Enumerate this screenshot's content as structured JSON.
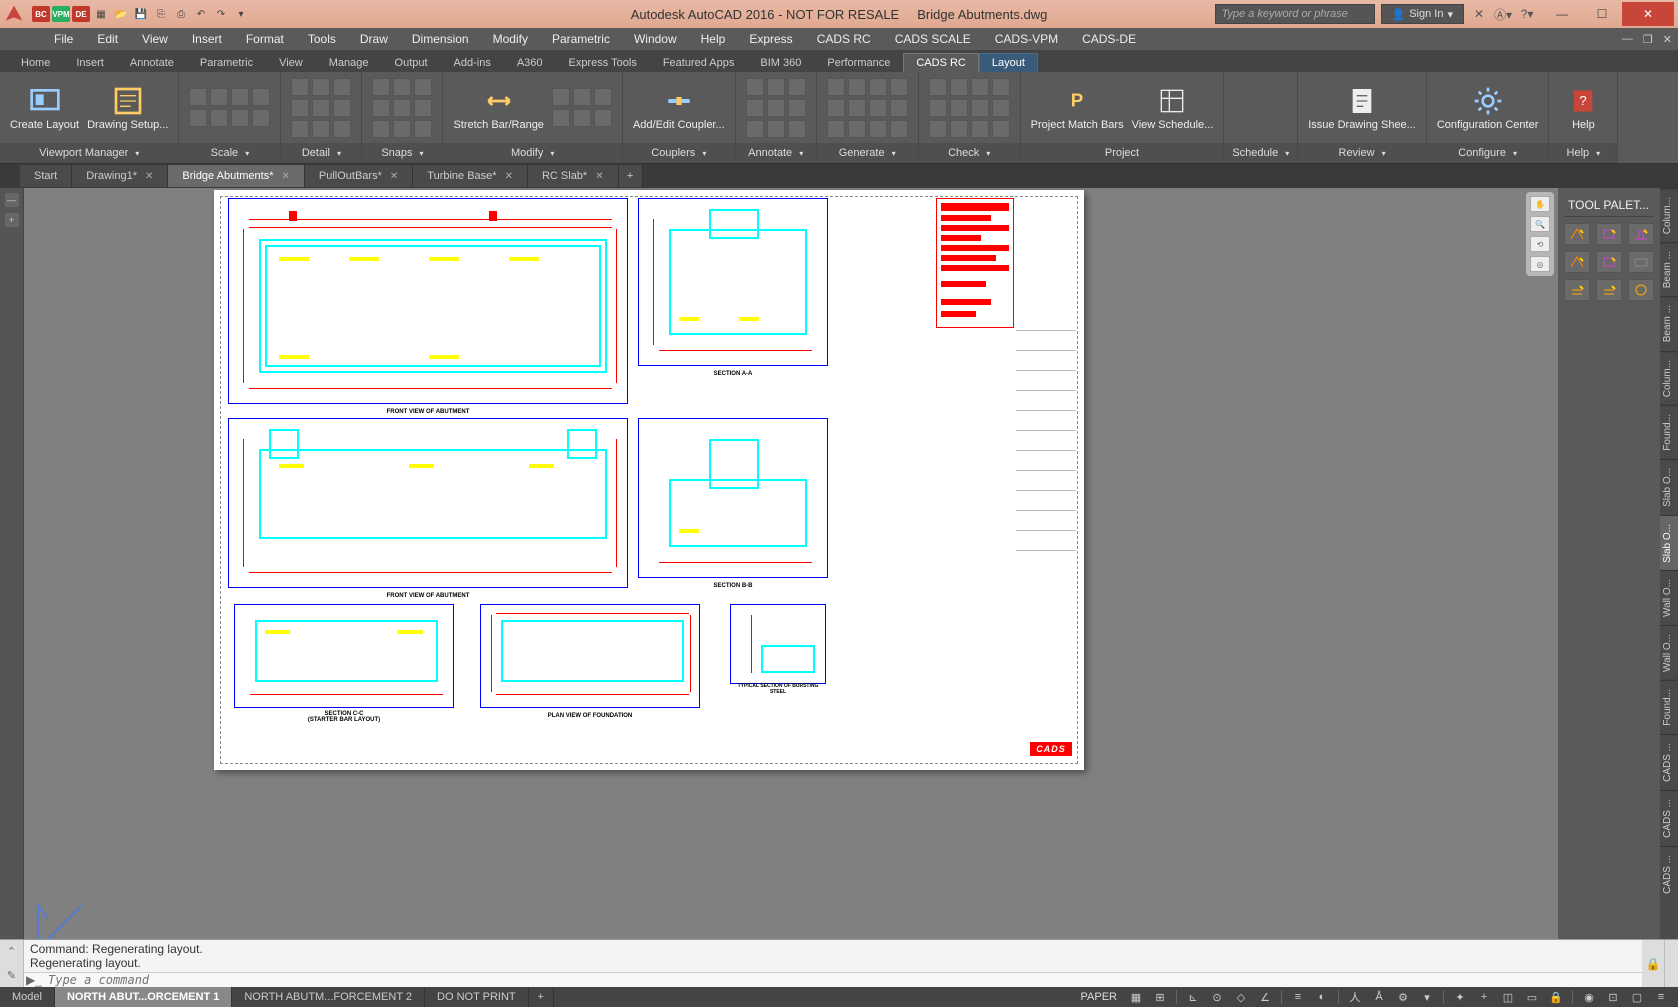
{
  "titlebar": {
    "app_title": "Autodesk AutoCAD 2016 - NOT FOR RESALE",
    "file_title": "Bridge Abutments.dwg",
    "search_placeholder": "Type a keyword or phrase",
    "signin": "Sign In",
    "qat_badges": [
      {
        "label": "BC",
        "color": "#c0392b"
      },
      {
        "label": "VPM",
        "color": "#27ae60"
      },
      {
        "label": "DE",
        "color": "#c0392b"
      }
    ]
  },
  "menus": [
    "File",
    "Edit",
    "View",
    "Insert",
    "Format",
    "Tools",
    "Draw",
    "Dimension",
    "Modify",
    "Parametric",
    "Window",
    "Help",
    "Express",
    "CADS RC",
    "CADS SCALE",
    "CADS-VPM",
    "CADS-DE"
  ],
  "ribbon_tabs": [
    "Home",
    "Insert",
    "Annotate",
    "Parametric",
    "View",
    "Manage",
    "Output",
    "Add-ins",
    "A360",
    "Express Tools",
    "Featured Apps",
    "BIM 360",
    "Performance",
    "CADS RC",
    "Layout"
  ],
  "ribbon_active_tab": "CADS RC",
  "ribbon_context_tab": "Layout",
  "ribbon_panels": [
    {
      "title": "Viewport Manager",
      "buttons": [
        {
          "label": "Create Layout"
        },
        {
          "label": "Drawing Setup..."
        }
      ]
    },
    {
      "title": "Scale",
      "grid": 12
    },
    {
      "title": "Detail",
      "grid": 12
    },
    {
      "title": "Snaps",
      "grid": 9
    },
    {
      "title": "Modify",
      "buttons": [
        {
          "label": "Stretch Bar/Range"
        }
      ],
      "grid": 6
    },
    {
      "title": "Couplers",
      "buttons": [
        {
          "label": "Add/Edit Coupler..."
        }
      ]
    },
    {
      "title": "Annotate",
      "grid": 9
    },
    {
      "title": "Generate",
      "grid": 12
    },
    {
      "title": "Check",
      "grid": 12
    },
    {
      "title": "Project",
      "buttons": [
        {
          "label": "Project Match Bars"
        },
        {
          "label": "View Schedule..."
        }
      ]
    },
    {
      "title": "Schedule"
    },
    {
      "title": "Review",
      "buttons": [
        {
          "label": "Issue Drawing Shee..."
        }
      ]
    },
    {
      "title": "Configure",
      "buttons": [
        {
          "label": "Configuration Center"
        }
      ]
    },
    {
      "title": "Help",
      "buttons": [
        {
          "label": "Help"
        }
      ]
    }
  ],
  "file_tabs": [
    {
      "label": "Start",
      "closable": false
    },
    {
      "label": "Drawing1*",
      "closable": true
    },
    {
      "label": "Bridge Abutments*",
      "closable": true,
      "active": true
    },
    {
      "label": "PullOutBars*",
      "closable": true
    },
    {
      "label": "Turbine Base*",
      "closable": true
    },
    {
      "label": "RC Slab*",
      "closable": true
    }
  ],
  "drawing": {
    "viewports": [
      {
        "label": "FRONT VIEW OF ABUTMENT"
      },
      {
        "label": "SECTION A-A"
      },
      {
        "label": "FRONT VIEW OF ABUTMENT"
      },
      {
        "label": "SECTION B-B"
      },
      {
        "label": "SECTION C-C\n(STARTER BAR LAYOUT)"
      },
      {
        "label": "PLAN VIEW OF FOUNDATION"
      },
      {
        "label": "TYPICAL SECTION OF BURSTING STEEL"
      }
    ],
    "notes_title": "NOTES",
    "cads_logo": "CADS"
  },
  "tool_palette": {
    "title": "TOOL PALET...",
    "tabs": [
      "Colum...",
      "Beam ...",
      "Beam ...",
      "Colum...",
      "Found...",
      "Slab O...",
      "Slab O...",
      "Wall O...",
      "Wall O...",
      "Found...",
      "CADS ...",
      "CADS ...",
      "CADS ..."
    ],
    "active_tab_index": 6
  },
  "command": {
    "history_line1": "Command:  Regenerating layout.",
    "history_line2": "Regenerating layout.",
    "prompt_placeholder": "Type a command"
  },
  "layout_tabs": [
    {
      "label": "Model"
    },
    {
      "label": "NORTH ABUT...ORCEMENT 1",
      "active": true
    },
    {
      "label": "NORTH ABUTM...FORCEMENT 2"
    },
    {
      "label": "DO NOT PRINT"
    }
  ],
  "status": {
    "space": "PAPER"
  }
}
